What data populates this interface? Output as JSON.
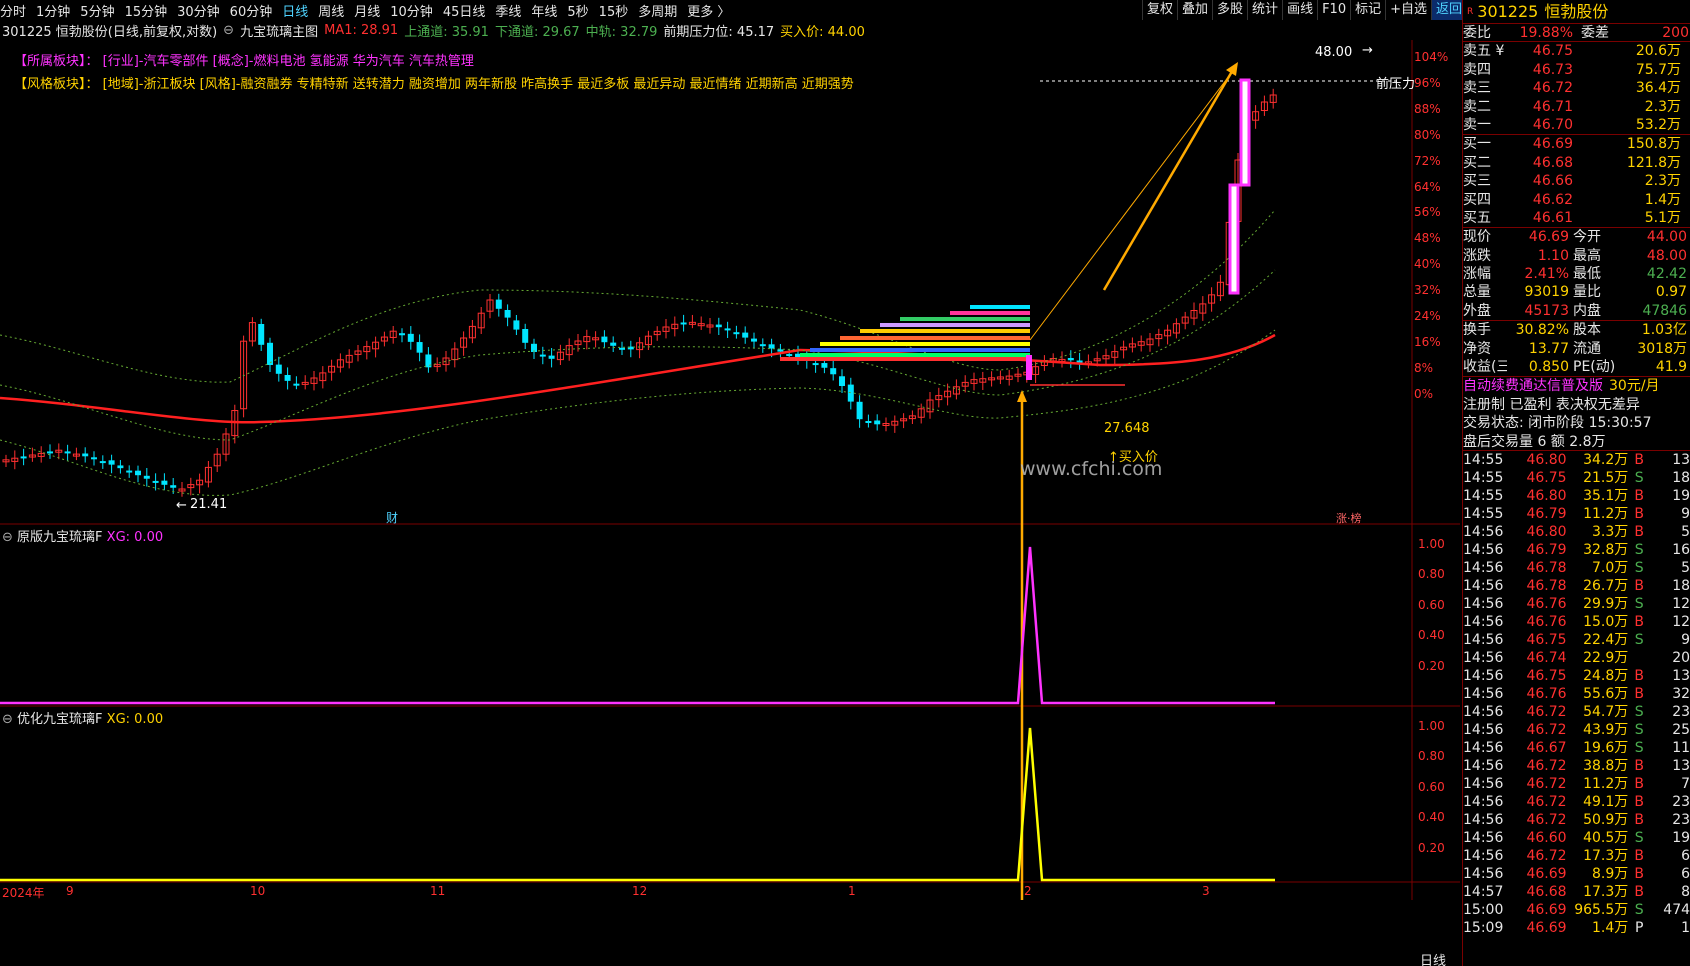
{
  "nav": {
    "periods": [
      "分时",
      "1分钟",
      "5分钟",
      "15分钟",
      "30分钟",
      "60分钟",
      "日线",
      "周线",
      "月线",
      "10分钟",
      "45日线",
      "季线",
      "年线",
      "5秒",
      "15秒",
      "多周期",
      "更多 〉"
    ],
    "active": "日线",
    "tools": [
      "复权",
      "叠加",
      "多股",
      "统计",
      "画线",
      "F10",
      "标记",
      "+自选",
      "返回"
    ]
  },
  "info": {
    "title": "301225 恒勃股份(日线,前复权,对数)",
    "indicator": "九宝琉璃主图",
    "ma1": "MA1: 28.91",
    "upper": "上通道: 35.91",
    "lower": "下通道: 29.67",
    "mid": "中轨: 32.79",
    "prev_pressure": "前期压力位: 45.17",
    "buy_price": "买入价: 44.00"
  },
  "sectors": {
    "line1_label": "【所属板块】：",
    "line1_items": "[行业]-汽车零部件 [概念]-燃料电池 氢能源 华为汽车 汽车热管理",
    "line2_label": "【风格板块】：",
    "line2_items": "[地域]-浙江板块 [风格]-融资融券 专精特新 送转潜力 融资增加 两年新股 昨高换手 最近多板 最近异动 最近情绪 近期新高 近期强势"
  },
  "main_chart": {
    "pct_labels": [
      "104%",
      "96%",
      "88%",
      "80%",
      "72%",
      "64%",
      "56%",
      "48%",
      "40%",
      "32%",
      "24%",
      "16%",
      "8%",
      "0%"
    ],
    "ann_high": "48.00",
    "ann_low": "21.41",
    "ann_buy": "27.648",
    "ann_buy_text": "↑买入价",
    "ann_pressure": "前压力",
    "fin_mark": "财",
    "limit_mark": "涨·榜",
    "watermark": "www.cfchi.com"
  },
  "sub1": {
    "title": "原版九宝琉璃F",
    "xg": "XG: 0.00",
    "labels": [
      "1.00",
      "0.80",
      "0.60",
      "0.40",
      "0.20"
    ]
  },
  "sub2": {
    "title": "优化九宝琉璃F",
    "xg": "XG: 0.00",
    "labels": [
      "1.00",
      "0.80",
      "0.60",
      "0.40",
      "0.20"
    ]
  },
  "xaxis": {
    "labels": [
      "2024年",
      "9",
      "10",
      "11",
      "12",
      "1",
      "2",
      "3"
    ],
    "period": "日线"
  },
  "quote": {
    "code": "301225",
    "name": "恒勃股份",
    "webi_label": "委比",
    "webi": "19.88%",
    "wecha_label": "委差",
    "wecha": "200",
    "asks": [
      {
        "l": "卖五 ¥",
        "p": "46.75",
        "v": "20.6万"
      },
      {
        "l": "卖四",
        "p": "46.73",
        "v": "75.7万"
      },
      {
        "l": "卖三",
        "p": "46.72",
        "v": "36.4万"
      },
      {
        "l": "卖二",
        "p": "46.71",
        "v": "2.3万"
      },
      {
        "l": "卖一",
        "p": "46.70",
        "v": "53.2万"
      }
    ],
    "bids": [
      {
        "l": "买一",
        "p": "46.69",
        "v": "150.8万"
      },
      {
        "l": "买二",
        "p": "46.68",
        "v": "121.8万"
      },
      {
        "l": "买三",
        "p": "46.66",
        "v": "2.3万"
      },
      {
        "l": "买四",
        "p": "46.62",
        "v": "1.4万"
      },
      {
        "l": "买五",
        "p": "46.61",
        "v": "5.1万"
      }
    ],
    "stats": [
      {
        "a": "现价",
        "av": "46.69",
        "b": "今开",
        "bv": "44.00"
      },
      {
        "a": "涨跌",
        "av": "1.10",
        "b": "最高",
        "bv": "48.00"
      },
      {
        "a": "涨幅",
        "av": "2.41%",
        "b": "最低",
        "bv": "42.42"
      },
      {
        "a": "总量",
        "av": "93019",
        "b": "量比",
        "bv": "0.97"
      },
      {
        "a": "外盘",
        "av": "45173",
        "b": "内盘",
        "bv": "47846"
      }
    ],
    "stats2": [
      {
        "a": "换手",
        "av": "30.82%",
        "b": "股本",
        "bv": "1.03亿"
      },
      {
        "a": "净资",
        "av": "13.77",
        "b": "流通",
        "bv": "3018万"
      },
      {
        "a": "收益(三)",
        "av": "0.850",
        "b": "PE(动)",
        "bv": "41.9"
      }
    ],
    "promo": "自动续费通达信普及版",
    "promo_price": "30元/月",
    "reg": "注册制 已盈利 表决权无差异",
    "trade_state": "交易状态: 闭市阶段 15:30:57",
    "after": "盘后交易量 6 额 2.8万"
  },
  "ticks": [
    {
      "t": "14:55",
      "p": "46.80",
      "v": "34.2万",
      "s": "B",
      "n": "13"
    },
    {
      "t": "14:55",
      "p": "46.75",
      "v": "21.5万",
      "s": "S",
      "n": "18"
    },
    {
      "t": "14:55",
      "p": "46.80",
      "v": "35.1万",
      "s": "B",
      "n": "19"
    },
    {
      "t": "14:55",
      "p": "46.79",
      "v": "11.2万",
      "s": "B",
      "n": "9"
    },
    {
      "t": "14:56",
      "p": "46.80",
      "v": "3.3万",
      "s": "B",
      "n": "5"
    },
    {
      "t": "14:56",
      "p": "46.79",
      "v": "32.8万",
      "s": "S",
      "n": "16"
    },
    {
      "t": "14:56",
      "p": "46.78",
      "v": "7.0万",
      "s": "S",
      "n": "5"
    },
    {
      "t": "14:56",
      "p": "46.78",
      "v": "26.7万",
      "s": "B",
      "n": "18"
    },
    {
      "t": "14:56",
      "p": "46.76",
      "v": "29.9万",
      "s": "S",
      "n": "12"
    },
    {
      "t": "14:56",
      "p": "46.76",
      "v": "15.0万",
      "s": "B",
      "n": "12"
    },
    {
      "t": "14:56",
      "p": "46.75",
      "v": "22.4万",
      "s": "S",
      "n": "9"
    },
    {
      "t": "14:56",
      "p": "46.74",
      "v": "22.9万",
      "s": "",
      "n": "20"
    },
    {
      "t": "14:56",
      "p": "46.75",
      "v": "24.8万",
      "s": "B",
      "n": "13"
    },
    {
      "t": "14:56",
      "p": "46.76",
      "v": "55.6万",
      "s": "B",
      "n": "32"
    },
    {
      "t": "14:56",
      "p": "46.72",
      "v": "54.7万",
      "s": "S",
      "n": "23"
    },
    {
      "t": "14:56",
      "p": "46.72",
      "v": "43.9万",
      "s": "S",
      "n": "25"
    },
    {
      "t": "14:56",
      "p": "46.67",
      "v": "19.6万",
      "s": "S",
      "n": "11"
    },
    {
      "t": "14:56",
      "p": "46.72",
      "v": "38.8万",
      "s": "B",
      "n": "13"
    },
    {
      "t": "14:56",
      "p": "46.72",
      "v": "11.2万",
      "s": "B",
      "n": "7"
    },
    {
      "t": "14:56",
      "p": "46.72",
      "v": "49.1万",
      "s": "B",
      "n": "23"
    },
    {
      "t": "14:56",
      "p": "46.72",
      "v": "50.9万",
      "s": "B",
      "n": "23"
    },
    {
      "t": "14:56",
      "p": "46.60",
      "v": "40.5万",
      "s": "S",
      "n": "19"
    },
    {
      "t": "14:56",
      "p": "46.72",
      "v": "17.3万",
      "s": "B",
      "n": "6"
    },
    {
      "t": "14:56",
      "p": "46.69",
      "v": "8.9万",
      "s": "B",
      "n": "6"
    },
    {
      "t": "14:57",
      "p": "46.68",
      "v": "17.3万",
      "s": "B",
      "n": "8"
    },
    {
      "t": "15:00",
      "p": "46.69",
      "v": "965.5万",
      "s": "S",
      "n": "474"
    },
    {
      "t": "15:09",
      "p": "46.69",
      "v": "1.4万",
      "s": "P",
      "n": "1"
    }
  ]
}
